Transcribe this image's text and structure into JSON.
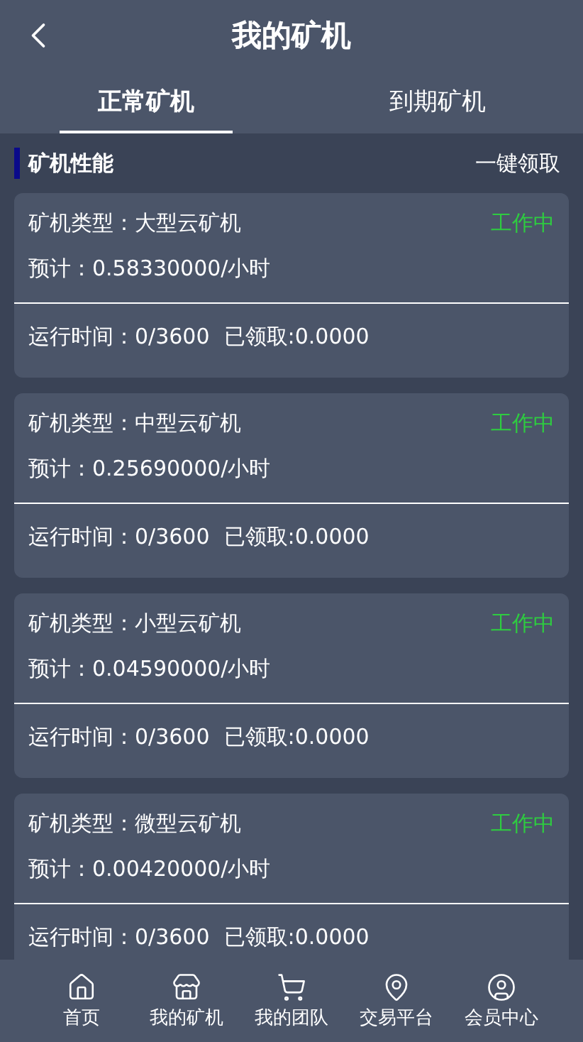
{
  "header": {
    "title": "我的矿机"
  },
  "tabs": [
    {
      "label": "正常矿机",
      "selected": true
    },
    {
      "label": "到期矿机",
      "selected": false
    }
  ],
  "section": {
    "title": "矿机性能",
    "action": "一键领取"
  },
  "machines": [
    {
      "type": "矿机类型：大型云矿机",
      "status": "工作中",
      "rate": "预计：0.58330000/小时",
      "runtime": "运行时间：0/3600",
      "claimed": "已领取:0.0000"
    },
    {
      "type": "矿机类型：中型云矿机",
      "status": "工作中",
      "rate": "预计：0.25690000/小时",
      "runtime": "运行时间：0/3600",
      "claimed": "已领取:0.0000"
    },
    {
      "type": "矿机类型：小型云矿机",
      "status": "工作中",
      "rate": "预计：0.04590000/小时",
      "runtime": "运行时间：0/3600",
      "claimed": "已领取:0.0000"
    },
    {
      "type": "矿机类型：微型云矿机",
      "status": "工作中",
      "rate": "预计：0.00420000/小时",
      "runtime": "运行时间：0/3600",
      "claimed": "已领取:0.0000"
    }
  ],
  "nav": [
    {
      "kind": "home",
      "label": "首页"
    },
    {
      "kind": "store",
      "label": "我的矿机"
    },
    {
      "kind": "cart",
      "label": "我的团队"
    },
    {
      "kind": "pin",
      "label": "交易平台"
    },
    {
      "kind": "user",
      "label": "会员中心"
    }
  ]
}
